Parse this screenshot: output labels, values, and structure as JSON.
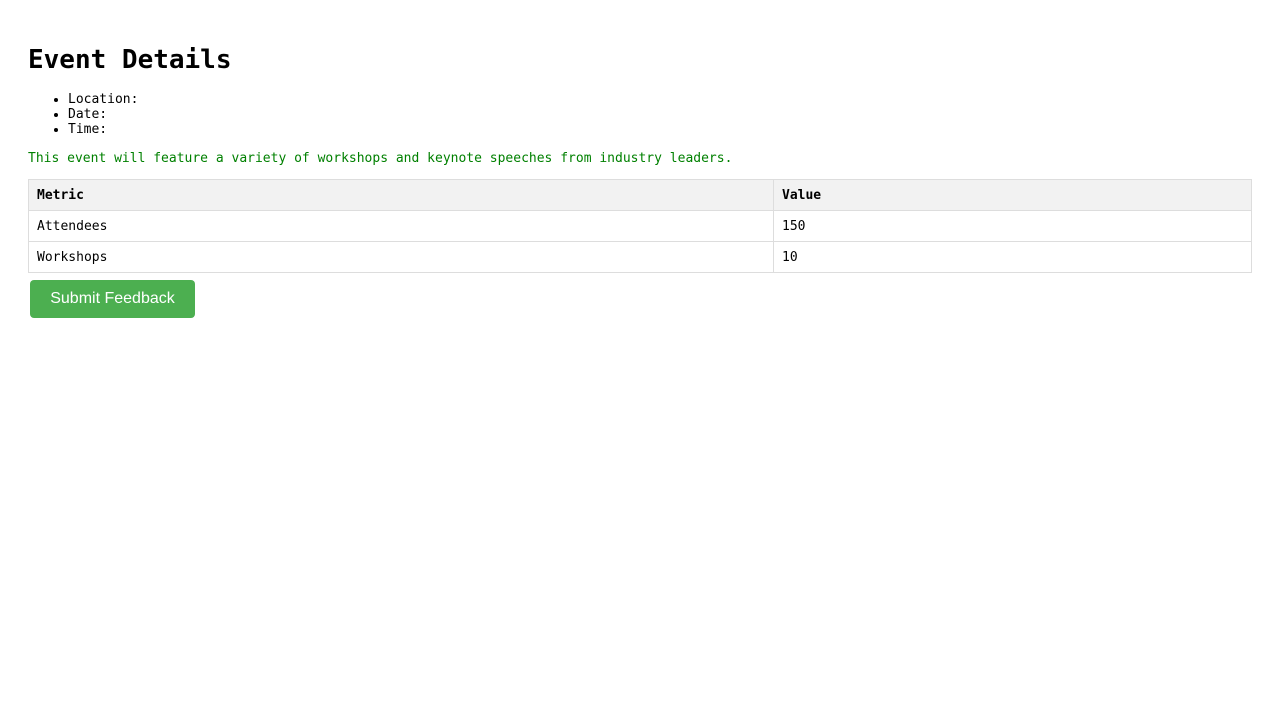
{
  "page": {
    "title": "Event Details"
  },
  "details": [
    {
      "label": "Location:"
    },
    {
      "label": "Date:"
    },
    {
      "label": "Time:"
    }
  ],
  "description": "This event will feature a variety of workshops and keynote speeches from industry leaders.",
  "table": {
    "headers": [
      "Metric",
      "Value"
    ],
    "rows": [
      [
        "Attendees",
        "150"
      ],
      [
        "Workshops",
        "10"
      ]
    ]
  },
  "submit_label": "Submit Feedback",
  "colors": {
    "accent": "#4caf50",
    "description_text": "#008000",
    "header_bg": "#f2f2f2",
    "border": "#dddddd"
  }
}
